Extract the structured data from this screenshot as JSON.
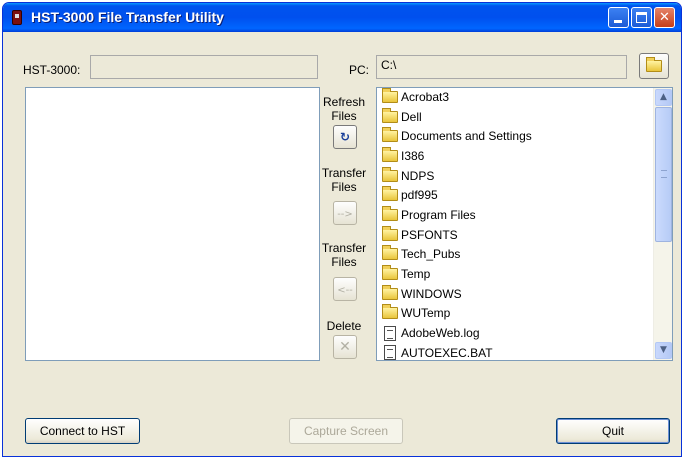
{
  "window": {
    "title": "HST-3000 File Transfer Utility"
  },
  "hst": {
    "label": "HST-3000:",
    "value": ""
  },
  "pc": {
    "label": "PC:",
    "path": "C:\\"
  },
  "actions": {
    "refresh_label": "Refresh Files",
    "transfer_to_pc_label": "Transfer Files",
    "transfer_to_pc_glyph": "-->",
    "transfer_to_hst_label": "Transfer Files",
    "transfer_to_hst_glyph": "<--",
    "delete_label": "Delete",
    "delete_glyph": "✕"
  },
  "pc_files": [
    {
      "name": "Acrobat3",
      "type": "folder"
    },
    {
      "name": "Dell",
      "type": "folder"
    },
    {
      "name": "Documents and Settings",
      "type": "folder"
    },
    {
      "name": "I386",
      "type": "folder"
    },
    {
      "name": "NDPS",
      "type": "folder"
    },
    {
      "name": "pdf995",
      "type": "folder"
    },
    {
      "name": "Program Files",
      "type": "folder"
    },
    {
      "name": "PSFONTS",
      "type": "folder"
    },
    {
      "name": "Tech_Pubs",
      "type": "folder"
    },
    {
      "name": "Temp",
      "type": "folder"
    },
    {
      "name": "WINDOWS",
      "type": "folder"
    },
    {
      "name": "WUTemp",
      "type": "folder"
    },
    {
      "name": "AdobeWeb.log",
      "type": "file"
    },
    {
      "name": "AUTOEXEC.BAT",
      "type": "file"
    }
  ],
  "buttons": {
    "connect": "Connect to HST",
    "capture": "Capture Screen",
    "quit": "Quit"
  },
  "colors": {
    "titlebar": "#0055ea",
    "window_bg": "#ece9d8",
    "folder": "#f1d05a"
  }
}
